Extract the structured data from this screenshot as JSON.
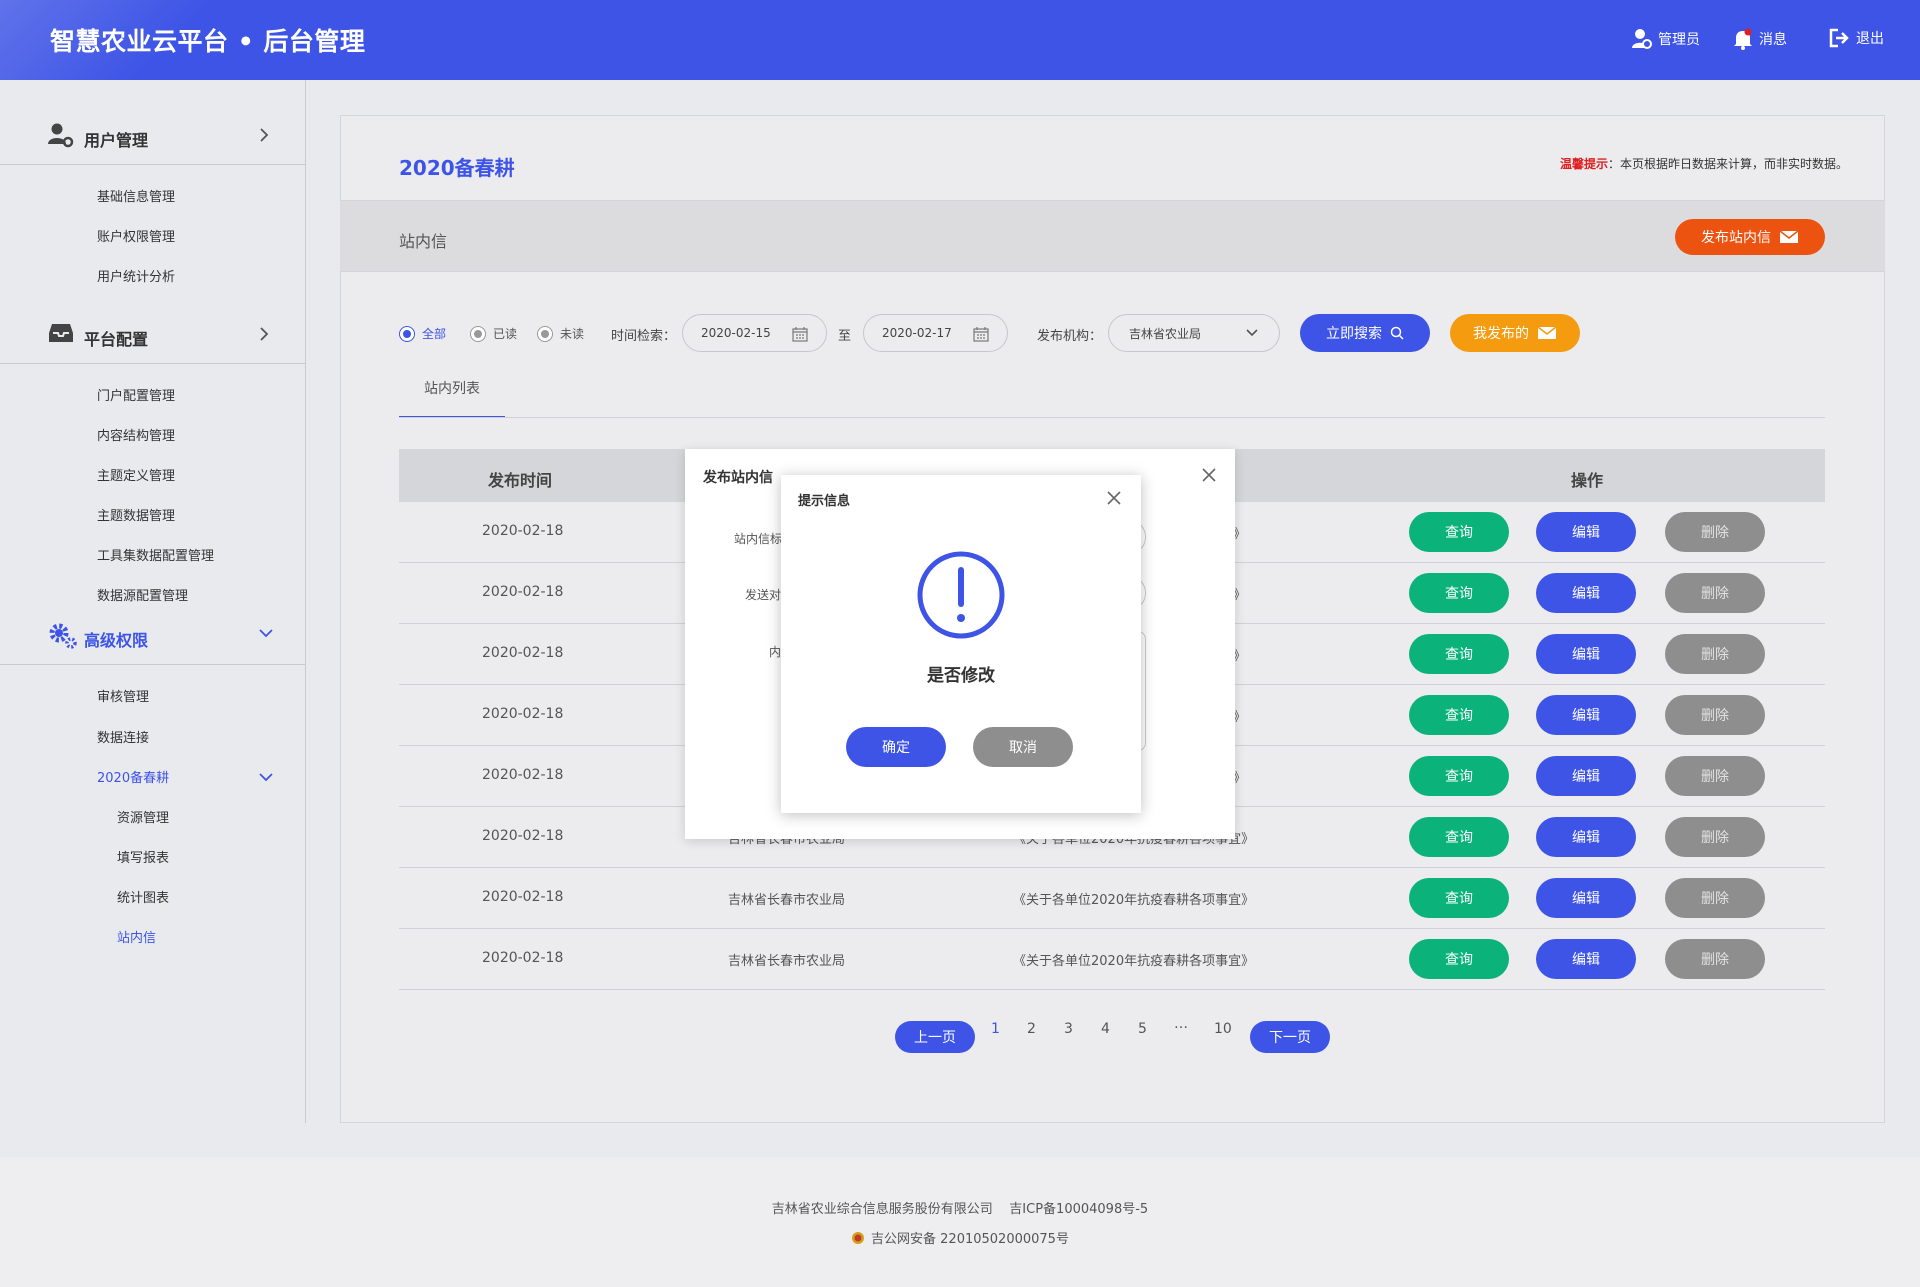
{
  "header": {
    "title": "智慧农业云平台 • 后台管理",
    "admin": "管理员",
    "messages": "消息",
    "logout": "退出"
  },
  "sidebar": {
    "groups": [
      {
        "label": "用户管理",
        "icon": "user-gear-icon",
        "items": [
          "基础信息管理",
          "账户权限管理",
          "用户统计分析"
        ]
      },
      {
        "label": "平台配置",
        "icon": "inbox-icon",
        "items": [
          "门户配置管理",
          "内容结构管理",
          "主题定义管理",
          "主题数据管理",
          "工具集数据配置管理",
          "数据源配置管理"
        ]
      },
      {
        "label": "高级权限",
        "icon": "gears-icon",
        "items": [
          "审核管理",
          "数据连接"
        ]
      }
    ],
    "submenu": {
      "label": "2020备春耕",
      "items": [
        "资源管理",
        "填写报表",
        "统计图表",
        "站内信"
      ]
    }
  },
  "main": {
    "title": "2020备春耕",
    "tip_label": "温馨提示",
    "tip_text": "：本页根据昨日数据来计算，而非实时数据。",
    "section": "站内信",
    "publish_button": "发布站内信",
    "filters": {
      "radios": [
        "全部",
        "已读",
        "未读"
      ],
      "time_label": "时间检索：",
      "date_from": "2020-02-15",
      "date_sep": "至",
      "date_to": "2020-02-17",
      "org_label": "发布机构：",
      "org_value": "吉林省农业局",
      "search_button": "立即搜索",
      "mine_button": "我发布的"
    },
    "tab": "站内列表",
    "table": {
      "headers": [
        "发布时间",
        "操作"
      ],
      "rows": [
        {
          "date": "2020-02-18",
          "org": "",
          "msg": "》"
        },
        {
          "date": "2020-02-18",
          "org": "",
          "msg": "》"
        },
        {
          "date": "2020-02-18",
          "org": "",
          "msg": "》"
        },
        {
          "date": "2020-02-18",
          "org": "",
          "msg": "》"
        },
        {
          "date": "2020-02-18",
          "org": "",
          "msg": "》"
        },
        {
          "date": "2020-02-18",
          "org": "吉林省长春市农业局",
          "msg": "《关于各单位2020年抗疫春耕各项事宜》"
        },
        {
          "date": "2020-02-18",
          "org": "吉林省长春市农业局",
          "msg": "《关于各单位2020年抗疫春耕各项事宜》"
        },
        {
          "date": "2020-02-18",
          "org": "吉林省长春市农业局",
          "msg": "《关于各单位2020年抗疫春耕各项事宜》"
        }
      ],
      "actions": {
        "query": "查询",
        "edit": "编辑",
        "delete": "删除"
      }
    },
    "pagination": {
      "prev": "上一页",
      "pages": [
        "1",
        "2",
        "3",
        "4",
        "5",
        "…",
        "10"
      ],
      "next": "下一页"
    }
  },
  "modal_publish": {
    "title": "发布站内信",
    "labels": [
      "站内信标",
      "发送对",
      "内"
    ]
  },
  "modal_confirm": {
    "title": "提示信息",
    "question": "是否修改",
    "ok": "确定",
    "cancel": "取消"
  },
  "footer": {
    "line1": "吉林省农业综合信息服务股份有限公司    吉ICP备10004098号-5",
    "line2": "吉公网安备 22010502000075号"
  },
  "colors": {
    "primary": "#3d54e6",
    "orange": "#ec5210",
    "amber": "#f59b10",
    "green": "#0bb37a",
    "gray": "#8e8e8e",
    "warn_red": "#e02020"
  }
}
